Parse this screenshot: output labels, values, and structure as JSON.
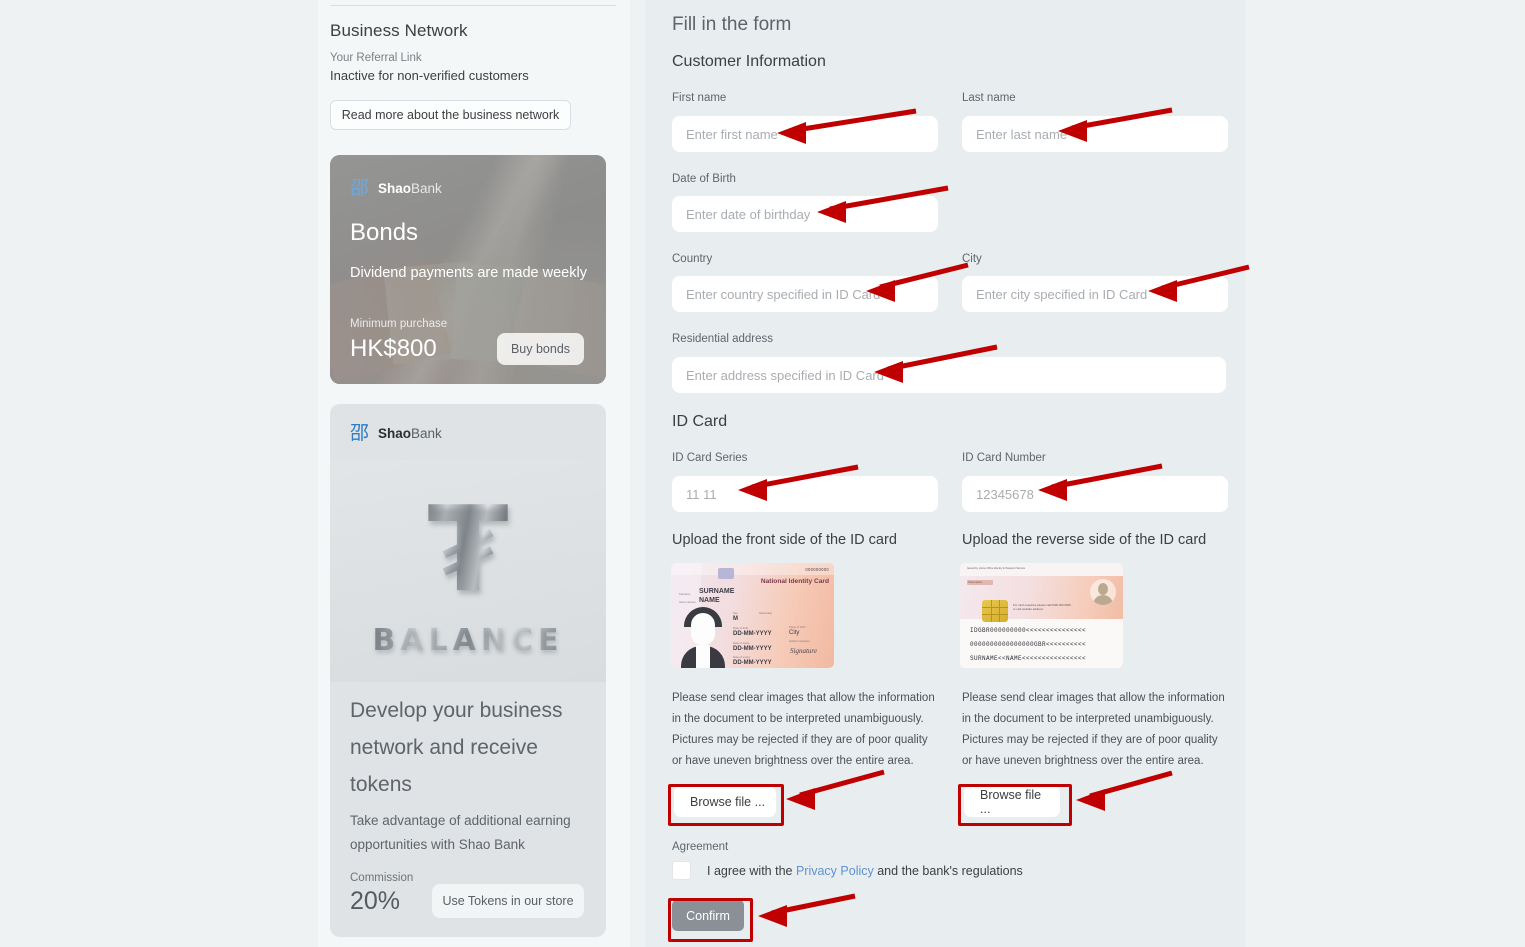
{
  "sidebar": {
    "business_network_title": "Business Network",
    "referral_label": "Your Referral Link",
    "referral_value": "Inactive for non-verified customers",
    "read_more_button": "Read more about the business network",
    "bonds_card": {
      "logo_glyph": "邵",
      "logo_bold": "Shao",
      "logo_light": "Bank",
      "title": "Bonds",
      "subtitle": "Dividend payments are made weekly",
      "min_purchase_label": "Minimum purchase",
      "price": "HK$800",
      "buy_button": "Buy bonds"
    },
    "tokens_card": {
      "logo_glyph": "邵",
      "logo_bold": "Shao",
      "logo_light": "Bank",
      "art_symbol": "₮",
      "art_word": "BALANCE",
      "title": "Develop your business network and receive tokens",
      "subtitle": "Take advantage of additional earning opportunities with Shao Bank",
      "commission_label": "Commission",
      "commission_value": "20%",
      "use_tokens_button": "Use Tokens in our store"
    }
  },
  "form": {
    "title": "Fill in the form",
    "customer_section": "Customer Information",
    "first_name_label": "First name",
    "first_name_placeholder": "Enter first name",
    "last_name_label": "Last name",
    "last_name_placeholder": "Enter last name",
    "dob_label": "Date of Birth",
    "dob_placeholder": "Enter date of birthday",
    "country_label": "Country",
    "country_placeholder": "Enter country specified in ID Card",
    "city_label": "City",
    "city_placeholder": "Enter city specified in ID Card",
    "address_label": "Residential address",
    "address_placeholder": "Enter address specified in ID Card",
    "id_card_section": "ID Card",
    "id_series_label": "ID Card Series",
    "id_series_placeholder": "11 11",
    "id_number_label": "ID Card Number",
    "id_number_placeholder": "12345678",
    "upload_front_title": "Upload the front side of the ID card",
    "upload_back_title": "Upload the reverse side of the ID card",
    "upload_hint": "Please send clear images that allow the information in the document to be interpreted unambiguously. Pictures may be rejected if they are of poor quality or have uneven brightness over the entire area.",
    "browse_button": "Browse file ...",
    "agreement_label": "Agreement",
    "agree_text_before": "I agree with the",
    "agree_link": "Privacy Policy",
    "agree_text_after": "and the bank's regulations",
    "confirm_button": "Confirm"
  },
  "id_card_sample_front": {
    "number": "000000000",
    "title": "National Identity Card",
    "surname": "SURNAME",
    "name": "NAME",
    "sex": "M",
    "date1": "DD-MM-YYYY",
    "date2": "DD-MM-YYYY",
    "date3": "DD-MM-YYYY",
    "city": "City",
    "signature": "Signature"
  },
  "id_card_sample_back": {
    "mrz_line1": "IDGBR000000000<<<<<<<<<<<<<<<",
    "mrz_line2": "0000000000000000GBR<<<<<<<<<<",
    "mrz_line3": "SURNAME<<NAME<<<<<<<<<<<<<<<<",
    "contact_note": "For card enquiries please call 0300 000 0000 or visit website address"
  },
  "colors": {
    "annotation_red": "#c00000",
    "link_blue": "#5d92d6",
    "logo_blue": "#2f7bc4",
    "panel_bg": "#e8edef",
    "page_bg": "#eef2f3"
  }
}
